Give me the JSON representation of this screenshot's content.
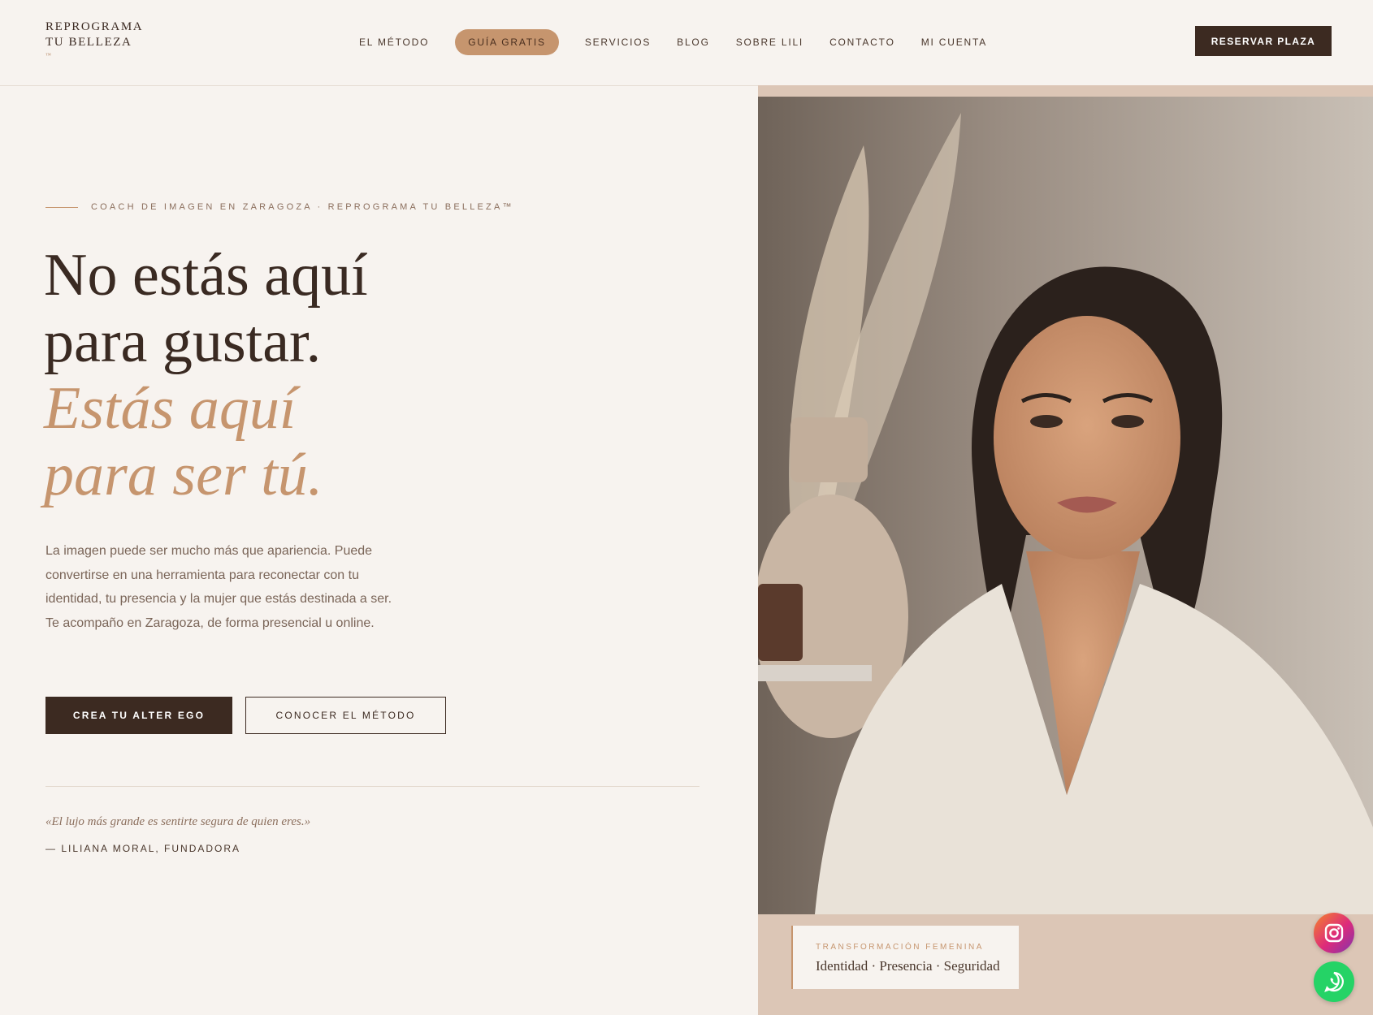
{
  "brand": {
    "line1": "REPROGRAMA",
    "line2": "TU BELLEZA",
    "tm": "™"
  },
  "nav": {
    "items": [
      {
        "label": "EL MÉTODO"
      },
      {
        "label": "GUÍA GRATIS",
        "highlight": true
      },
      {
        "label": "SERVICIOS"
      },
      {
        "label": "BLOG"
      },
      {
        "label": "SOBRE LILI"
      },
      {
        "label": "CONTACTO"
      },
      {
        "label": "MI CUENTA"
      }
    ],
    "cta": "RESERVAR PLAZA"
  },
  "hero": {
    "eyebrow": "COACH DE IMAGEN EN ZARAGOZA · REPROGRAMA TU BELLEZA™",
    "headline_1": "No estás aquí",
    "headline_2": "para gustar.",
    "headline_3": "Estás aquí",
    "headline_4": "para ser tú.",
    "intro": "La imagen puede ser mucho más que apariencia. Puede convertirse en una herramienta para reconectar con tu identidad, tu presencia y la mujer que estás destinada a ser. Te acompaño en Zaragoza, de forma presencial u online.",
    "primary_cta": "CREA TU ALTER EGO",
    "secondary_cta": "CONOCER EL MÉTODO",
    "quote": "«El lujo más grande es sentirte segura de quien eres.»",
    "quote_author": "— LILIANA MORAL, FUNDADORA"
  },
  "image_caption": {
    "label": "TRANSFORMACIÓN FEMENINA",
    "text": "Identidad · Presencia · Seguridad"
  },
  "floating": {
    "instagram": "instagram-icon",
    "whatsapp": "whatsapp-icon"
  },
  "colors": {
    "background": "#f7f3ef",
    "dark": "#3c2a21",
    "accent": "#c6956e",
    "panel": "#dcc6b6"
  }
}
